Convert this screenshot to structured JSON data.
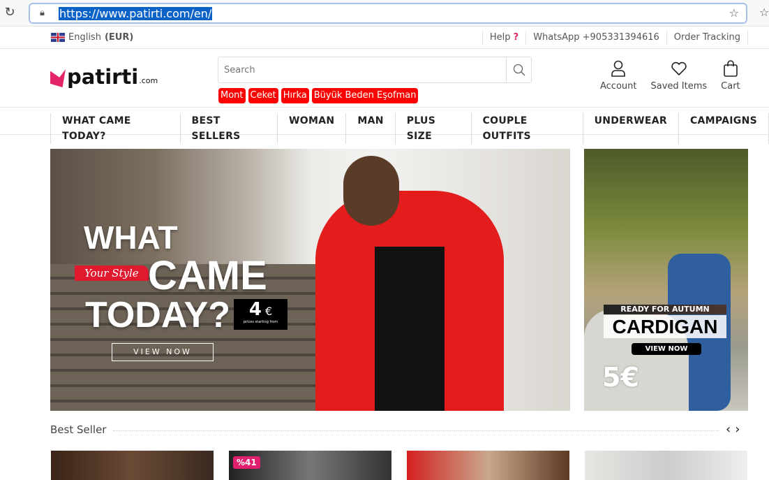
{
  "browser": {
    "url": "https://www.patirti.com/en/"
  },
  "topbar": {
    "language": "English",
    "currency": "(EUR)",
    "links": [
      {
        "label": "Help",
        "suffix": "?"
      },
      {
        "label": "WhatsApp +905331394616"
      },
      {
        "label": "Order Tracking"
      }
    ]
  },
  "header": {
    "logo": "patirti",
    "logo_suffix": ".com",
    "search_placeholder": "Search",
    "tags": [
      "Mont",
      "Ceket",
      "Hırka",
      "Büyük Beden Eşofman"
    ],
    "tag_color": "#ff0000",
    "icons": [
      {
        "label": "Account",
        "icon": "user-icon"
      },
      {
        "label": "Saved Items",
        "icon": "heart-icon"
      },
      {
        "label": "Cart",
        "icon": "bag-icon"
      }
    ]
  },
  "nav": [
    "WHAT CAME TODAY?",
    "BEST SELLERS",
    "WOMAN",
    "MAN",
    "PLUS SIZE",
    "COUPLE OUTFITS",
    "UNDERWEAR",
    "CAMPAIGNS"
  ],
  "hero": {
    "line1": "WHAT",
    "line2": "CAME",
    "line3": "TODAY?",
    "badge": "Your Style",
    "price": "4",
    "currency": "€",
    "price_note": "prices starting from",
    "cta": "VIEW NOW"
  },
  "side_banner": {
    "kicker": "READY FOR AUTUMN",
    "title": "CARDIGAN",
    "cta": "VIEW NOW",
    "price": "5€"
  },
  "best_seller": {
    "title": "Best Seller",
    "discount": "%41"
  },
  "colors": {
    "accent": "#e32468",
    "selection": "#0b63c8"
  }
}
